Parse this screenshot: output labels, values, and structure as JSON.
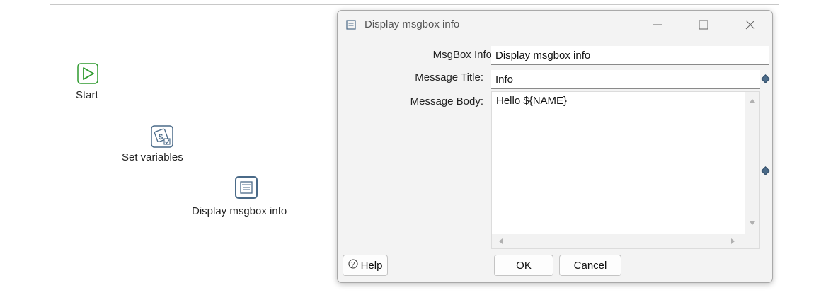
{
  "canvas": {
    "nodes": [
      {
        "label": "Start",
        "icon": "play-icon"
      },
      {
        "label": "Set variables",
        "icon": "set-variables-icon"
      },
      {
        "label": "Display msgbox info",
        "icon": "msgbox-icon"
      }
    ]
  },
  "dialog": {
    "title": "Display msgbox info",
    "fields": {
      "name_label": "MsgBox Info",
      "name_value": "Display msgbox info",
      "title_label": "Message Title:",
      "title_value": "Info",
      "body_label": "Message Body:",
      "body_value": "Hello ${NAME}"
    },
    "buttons": {
      "help": "Help",
      "ok": "OK",
      "cancel": "Cancel"
    }
  },
  "colors": {
    "start_icon": "#2e9a2e",
    "node_icon_border": "#4a6a88",
    "variable_diamond": "#4a6a88"
  }
}
